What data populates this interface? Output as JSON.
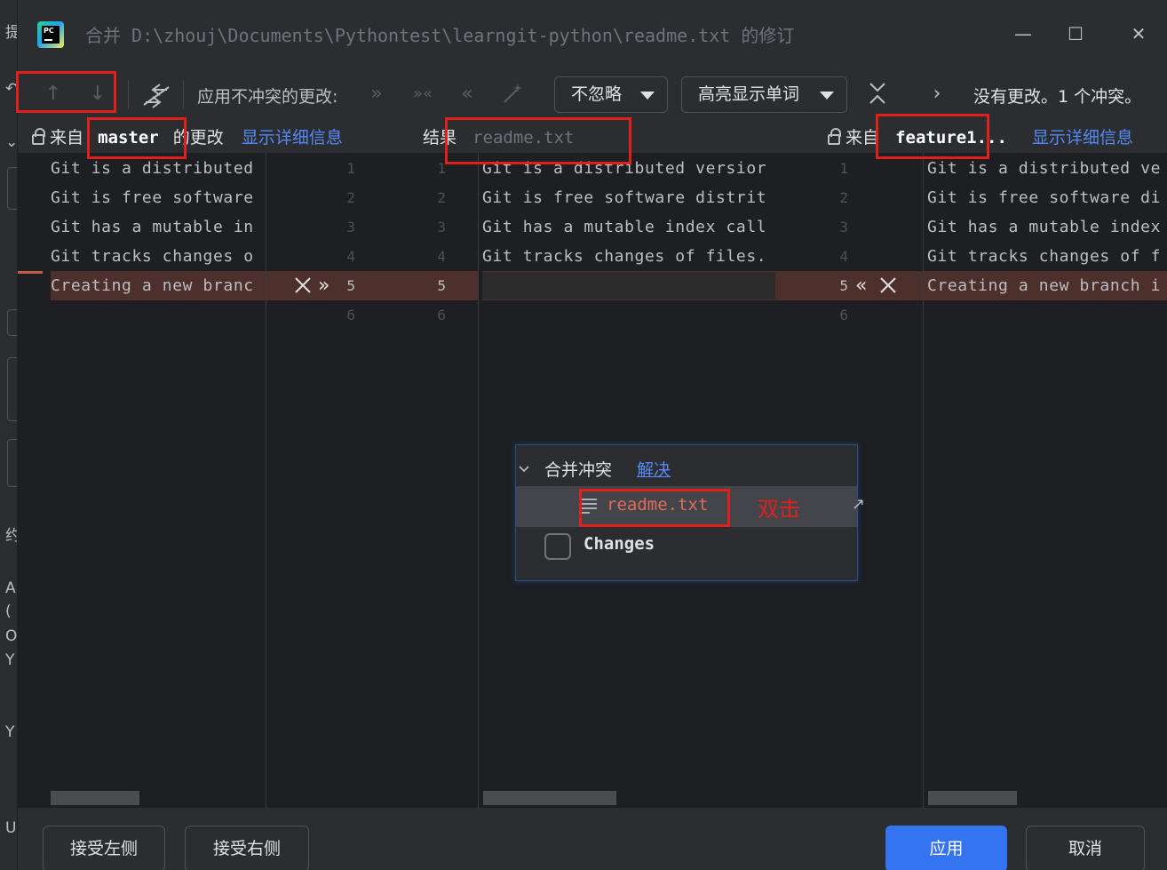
{
  "window": {
    "title": "合并 D:\\zhouj\\Documents\\Pythontest\\learngit-python\\readme.txt 的修订",
    "controls": {
      "minimize": "—",
      "maximize": "☐",
      "close": "✕"
    }
  },
  "left_strip": {
    "fragments": [
      "提",
      "↶",
      "⌄",
      "约",
      "A",
      "(",
      "O",
      "Y",
      "Y",
      "U"
    ]
  },
  "toolbar": {
    "prev_icon": "↑",
    "next_icon": "↓",
    "apply_nonconflicting_label": "应用不冲突的更改:",
    "ignore_dropdown": {
      "value": "不忽略"
    },
    "highlight_dropdown": {
      "value": "高亮显示单词"
    },
    "collapse_icon": "≚",
    "next_conflict_icon": "›",
    "status": "没有更改。1 个冲突。"
  },
  "headers": {
    "left": {
      "prefix": "来自",
      "branch": "master",
      "suffix": "的更改",
      "link": "显示详细信息"
    },
    "center": {
      "label": "结果",
      "file": "readme.txt"
    },
    "right": {
      "prefix": "来自",
      "branch": "feature1...",
      "link": "显示详细信息"
    }
  },
  "left_pane": {
    "lines": [
      "Git is a distributed",
      "Git is free software",
      "Git has a mutable in",
      "Git tracks changes o",
      "Creating a new branc"
    ],
    "gutter_numbers": [
      "1",
      "2",
      "3",
      "4",
      "5",
      "6"
    ]
  },
  "center_pane": {
    "gutter_numbers": [
      "1",
      "2",
      "3",
      "4",
      "5",
      "6"
    ],
    "lines": [
      "Git is a distributed versior",
      "Git is free software distrit",
      "Git has a mutable index call",
      "Git tracks changes of files.",
      ""
    ]
  },
  "right_pane": {
    "gutter_numbers": [
      "1",
      "2",
      "3",
      "4",
      "5",
      "6"
    ],
    "lines": [
      "Git is a distributed ve",
      "Git is free software di",
      "Git has a mutable index",
      "Git tracks changes of f",
      "Creating a new branch i"
    ]
  },
  "popup": {
    "group_label": "合并冲突",
    "resolve_link": "解决",
    "file": "readme.txt",
    "annotation": "双击",
    "changes_label": "Changes"
  },
  "footer": {
    "accept_left": "接受左侧",
    "accept_right": "接受右侧",
    "apply": "应用",
    "cancel": "取消"
  },
  "colors": {
    "conflict_bg": "#4d2f2b",
    "accent": "#3574f0",
    "link": "#548af7",
    "annotation_red": "#e0201d"
  }
}
